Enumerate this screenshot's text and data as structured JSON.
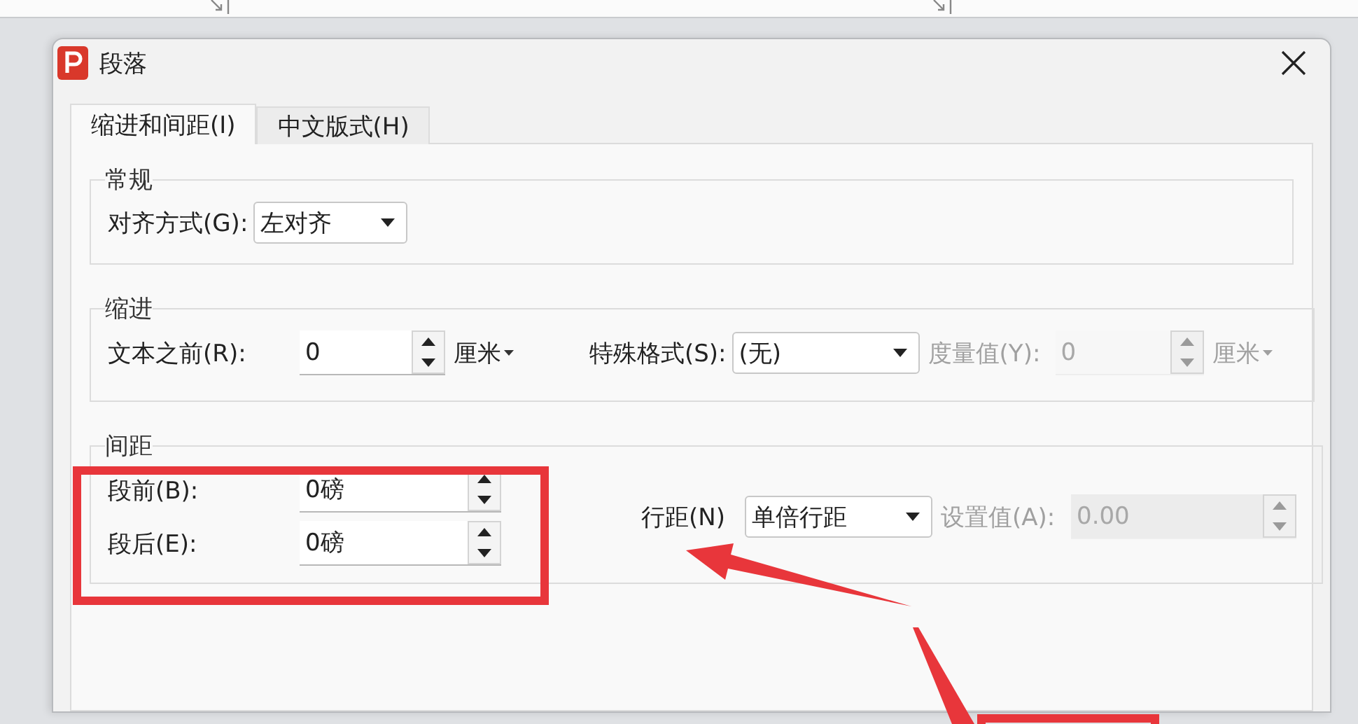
{
  "window": {
    "title": "段落"
  },
  "tabs": [
    {
      "label": "缩进和间距(I)",
      "selected": true
    },
    {
      "label": "中文版式(H)",
      "selected": false
    }
  ],
  "groups": [
    {
      "title": "常规",
      "columns": [
        [
          [
            {
              "kind": "label",
              "text": "对齐方式(G):",
              "disabled": false
            },
            {
              "kind": "select",
              "value": "左对齐",
              "disabled": false
            }
          ]
        ]
      ]
    },
    {
      "title": "缩进",
      "columns": [
        [
          [
            {
              "kind": "label",
              "text": "文本之前(R):",
              "disabled": false
            },
            {
              "kind": "spin",
              "value": "0",
              "disabled": false
            },
            {
              "kind": "unit",
              "text": "厘米",
              "disabled": false
            },
            {
              "kind": "label",
              "text": "特殊格式(S):",
              "disabled": false
            },
            {
              "kind": "select",
              "value": "(无)",
              "disabled": false
            },
            {
              "kind": "label",
              "text": "度量值(Y):",
              "disabled": true
            },
            {
              "kind": "spin",
              "value": "0",
              "disabled": true
            },
            {
              "kind": "unit",
              "text": "厘米",
              "disabled": true
            }
          ]
        ]
      ]
    },
    {
      "title": "间距",
      "columns": [
        [
          [
            {
              "kind": "label",
              "text": "段前(B):",
              "disabled": false
            },
            {
              "kind": "spin",
              "value": "0磅",
              "disabled": false
            }
          ],
          [
            {
              "kind": "label",
              "text": "段后(E):",
              "disabled": false
            },
            {
              "kind": "spin",
              "value": "0磅",
              "disabled": false
            }
          ]
        ],
        [
          [
            {
              "kind": "label",
              "text": "行距(N)",
              "disabled": false
            },
            {
              "kind": "select",
              "value": "单倍行距",
              "disabled": false
            },
            {
              "kind": "label",
              "text": "设置值(A):",
              "disabled": true
            },
            {
              "kind": "spin",
              "value": "0.00",
              "disabled": true,
              "filled": true
            }
          ]
        ]
      ]
    }
  ]
}
